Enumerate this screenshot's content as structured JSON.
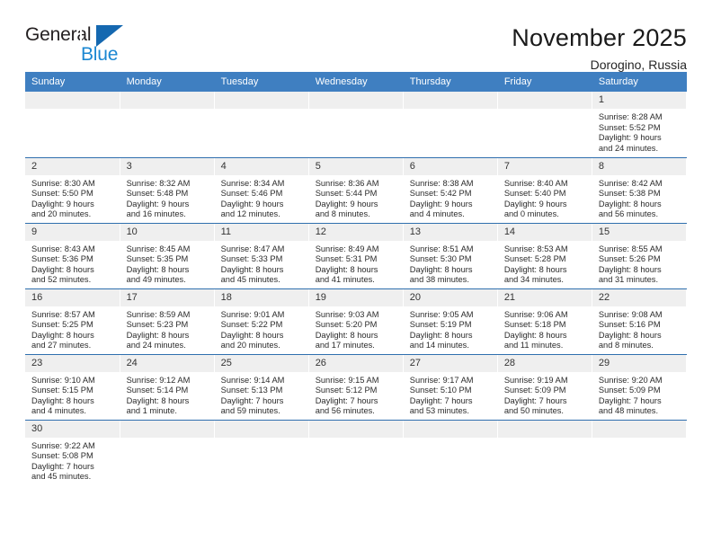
{
  "brand": {
    "name_top": "General",
    "name_bottom": "Blue",
    "accent_color": "#1b87d2",
    "triangle_color": "#1568b0",
    "triangle_icon": "triangle-right-icon"
  },
  "header": {
    "title": "November 2025",
    "subtitle": "Dorogino, Russia"
  },
  "theme": {
    "header_bar_color": "#3f7fc1",
    "row_rule_color": "#2f6fae",
    "daynum_bg": "#efefef",
    "page_bg": "#ffffff"
  },
  "weekdays": [
    "Sunday",
    "Monday",
    "Tuesday",
    "Wednesday",
    "Thursday",
    "Friday",
    "Saturday"
  ],
  "labels": {
    "sunrise_prefix": "Sunrise:",
    "sunset_prefix": "Sunset:",
    "daylight_prefix": "Daylight:"
  },
  "weeks": [
    [
      {
        "day": "",
        "sunrise": "",
        "sunset": "",
        "daylight1": "",
        "daylight2": "",
        "empty": true
      },
      {
        "day": "",
        "sunrise": "",
        "sunset": "",
        "daylight1": "",
        "daylight2": "",
        "empty": true
      },
      {
        "day": "",
        "sunrise": "",
        "sunset": "",
        "daylight1": "",
        "daylight2": "",
        "empty": true
      },
      {
        "day": "",
        "sunrise": "",
        "sunset": "",
        "daylight1": "",
        "daylight2": "",
        "empty": true
      },
      {
        "day": "",
        "sunrise": "",
        "sunset": "",
        "daylight1": "",
        "daylight2": "",
        "empty": true
      },
      {
        "day": "",
        "sunrise": "",
        "sunset": "",
        "daylight1": "",
        "daylight2": "",
        "empty": true
      },
      {
        "day": "1",
        "sunrise": "Sunrise: 8:28 AM",
        "sunset": "Sunset: 5:52 PM",
        "daylight1": "Daylight: 9 hours",
        "daylight2": "and 24 minutes.",
        "empty": false
      }
    ],
    [
      {
        "day": "2",
        "sunrise": "Sunrise: 8:30 AM",
        "sunset": "Sunset: 5:50 PM",
        "daylight1": "Daylight: 9 hours",
        "daylight2": "and 20 minutes.",
        "empty": false
      },
      {
        "day": "3",
        "sunrise": "Sunrise: 8:32 AM",
        "sunset": "Sunset: 5:48 PM",
        "daylight1": "Daylight: 9 hours",
        "daylight2": "and 16 minutes.",
        "empty": false
      },
      {
        "day": "4",
        "sunrise": "Sunrise: 8:34 AM",
        "sunset": "Sunset: 5:46 PM",
        "daylight1": "Daylight: 9 hours",
        "daylight2": "and 12 minutes.",
        "empty": false
      },
      {
        "day": "5",
        "sunrise": "Sunrise: 8:36 AM",
        "sunset": "Sunset: 5:44 PM",
        "daylight1": "Daylight: 9 hours",
        "daylight2": "and 8 minutes.",
        "empty": false
      },
      {
        "day": "6",
        "sunrise": "Sunrise: 8:38 AM",
        "sunset": "Sunset: 5:42 PM",
        "daylight1": "Daylight: 9 hours",
        "daylight2": "and 4 minutes.",
        "empty": false
      },
      {
        "day": "7",
        "sunrise": "Sunrise: 8:40 AM",
        "sunset": "Sunset: 5:40 PM",
        "daylight1": "Daylight: 9 hours",
        "daylight2": "and 0 minutes.",
        "empty": false
      },
      {
        "day": "8",
        "sunrise": "Sunrise: 8:42 AM",
        "sunset": "Sunset: 5:38 PM",
        "daylight1": "Daylight: 8 hours",
        "daylight2": "and 56 minutes.",
        "empty": false
      }
    ],
    [
      {
        "day": "9",
        "sunrise": "Sunrise: 8:43 AM",
        "sunset": "Sunset: 5:36 PM",
        "daylight1": "Daylight: 8 hours",
        "daylight2": "and 52 minutes.",
        "empty": false
      },
      {
        "day": "10",
        "sunrise": "Sunrise: 8:45 AM",
        "sunset": "Sunset: 5:35 PM",
        "daylight1": "Daylight: 8 hours",
        "daylight2": "and 49 minutes.",
        "empty": false
      },
      {
        "day": "11",
        "sunrise": "Sunrise: 8:47 AM",
        "sunset": "Sunset: 5:33 PM",
        "daylight1": "Daylight: 8 hours",
        "daylight2": "and 45 minutes.",
        "empty": false
      },
      {
        "day": "12",
        "sunrise": "Sunrise: 8:49 AM",
        "sunset": "Sunset: 5:31 PM",
        "daylight1": "Daylight: 8 hours",
        "daylight2": "and 41 minutes.",
        "empty": false
      },
      {
        "day": "13",
        "sunrise": "Sunrise: 8:51 AM",
        "sunset": "Sunset: 5:30 PM",
        "daylight1": "Daylight: 8 hours",
        "daylight2": "and 38 minutes.",
        "empty": false
      },
      {
        "day": "14",
        "sunrise": "Sunrise: 8:53 AM",
        "sunset": "Sunset: 5:28 PM",
        "daylight1": "Daylight: 8 hours",
        "daylight2": "and 34 minutes.",
        "empty": false
      },
      {
        "day": "15",
        "sunrise": "Sunrise: 8:55 AM",
        "sunset": "Sunset: 5:26 PM",
        "daylight1": "Daylight: 8 hours",
        "daylight2": "and 31 minutes.",
        "empty": false
      }
    ],
    [
      {
        "day": "16",
        "sunrise": "Sunrise: 8:57 AM",
        "sunset": "Sunset: 5:25 PM",
        "daylight1": "Daylight: 8 hours",
        "daylight2": "and 27 minutes.",
        "empty": false
      },
      {
        "day": "17",
        "sunrise": "Sunrise: 8:59 AM",
        "sunset": "Sunset: 5:23 PM",
        "daylight1": "Daylight: 8 hours",
        "daylight2": "and 24 minutes.",
        "empty": false
      },
      {
        "day": "18",
        "sunrise": "Sunrise: 9:01 AM",
        "sunset": "Sunset: 5:22 PM",
        "daylight1": "Daylight: 8 hours",
        "daylight2": "and 20 minutes.",
        "empty": false
      },
      {
        "day": "19",
        "sunrise": "Sunrise: 9:03 AM",
        "sunset": "Sunset: 5:20 PM",
        "daylight1": "Daylight: 8 hours",
        "daylight2": "and 17 minutes.",
        "empty": false
      },
      {
        "day": "20",
        "sunrise": "Sunrise: 9:05 AM",
        "sunset": "Sunset: 5:19 PM",
        "daylight1": "Daylight: 8 hours",
        "daylight2": "and 14 minutes.",
        "empty": false
      },
      {
        "day": "21",
        "sunrise": "Sunrise: 9:06 AM",
        "sunset": "Sunset: 5:18 PM",
        "daylight1": "Daylight: 8 hours",
        "daylight2": "and 11 minutes.",
        "empty": false
      },
      {
        "day": "22",
        "sunrise": "Sunrise: 9:08 AM",
        "sunset": "Sunset: 5:16 PM",
        "daylight1": "Daylight: 8 hours",
        "daylight2": "and 8 minutes.",
        "empty": false
      }
    ],
    [
      {
        "day": "23",
        "sunrise": "Sunrise: 9:10 AM",
        "sunset": "Sunset: 5:15 PM",
        "daylight1": "Daylight: 8 hours",
        "daylight2": "and 4 minutes.",
        "empty": false
      },
      {
        "day": "24",
        "sunrise": "Sunrise: 9:12 AM",
        "sunset": "Sunset: 5:14 PM",
        "daylight1": "Daylight: 8 hours",
        "daylight2": "and 1 minute.",
        "empty": false
      },
      {
        "day": "25",
        "sunrise": "Sunrise: 9:14 AM",
        "sunset": "Sunset: 5:13 PM",
        "daylight1": "Daylight: 7 hours",
        "daylight2": "and 59 minutes.",
        "empty": false
      },
      {
        "day": "26",
        "sunrise": "Sunrise: 9:15 AM",
        "sunset": "Sunset: 5:12 PM",
        "daylight1": "Daylight: 7 hours",
        "daylight2": "and 56 minutes.",
        "empty": false
      },
      {
        "day": "27",
        "sunrise": "Sunrise: 9:17 AM",
        "sunset": "Sunset: 5:10 PM",
        "daylight1": "Daylight: 7 hours",
        "daylight2": "and 53 minutes.",
        "empty": false
      },
      {
        "day": "28",
        "sunrise": "Sunrise: 9:19 AM",
        "sunset": "Sunset: 5:09 PM",
        "daylight1": "Daylight: 7 hours",
        "daylight2": "and 50 minutes.",
        "empty": false
      },
      {
        "day": "29",
        "sunrise": "Sunrise: 9:20 AM",
        "sunset": "Sunset: 5:09 PM",
        "daylight1": "Daylight: 7 hours",
        "daylight2": "and 48 minutes.",
        "empty": false
      }
    ],
    [
      {
        "day": "30",
        "sunrise": "Sunrise: 9:22 AM",
        "sunset": "Sunset: 5:08 PM",
        "daylight1": "Daylight: 7 hours",
        "daylight2": "and 45 minutes.",
        "empty": false
      },
      {
        "day": "",
        "sunrise": "",
        "sunset": "",
        "daylight1": "",
        "daylight2": "",
        "empty": true
      },
      {
        "day": "",
        "sunrise": "",
        "sunset": "",
        "daylight1": "",
        "daylight2": "",
        "empty": true
      },
      {
        "day": "",
        "sunrise": "",
        "sunset": "",
        "daylight1": "",
        "daylight2": "",
        "empty": true
      },
      {
        "day": "",
        "sunrise": "",
        "sunset": "",
        "daylight1": "",
        "daylight2": "",
        "empty": true
      },
      {
        "day": "",
        "sunrise": "",
        "sunset": "",
        "daylight1": "",
        "daylight2": "",
        "empty": true
      },
      {
        "day": "",
        "sunrise": "",
        "sunset": "",
        "daylight1": "",
        "daylight2": "",
        "empty": true
      }
    ]
  ]
}
